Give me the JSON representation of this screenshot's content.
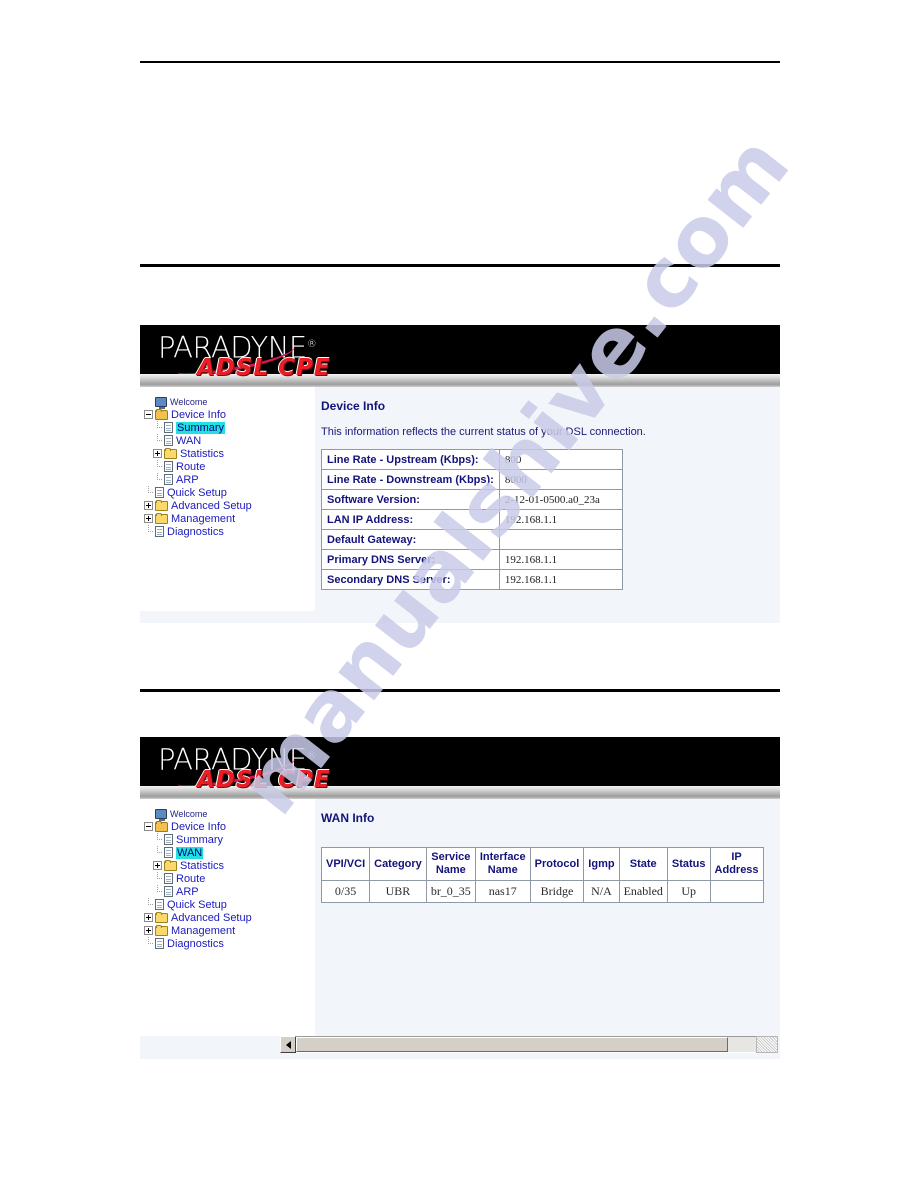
{
  "watermark": {
    "text": "manualshive.com",
    "color": "#c9cbe8"
  },
  "brand": {
    "logo_text": "PARADYNE",
    "logo_registered": "®",
    "tagline": "ADSL CPE",
    "tagline_color": "#e81f26"
  },
  "sidebar": {
    "items": [
      {
        "label": "Welcome",
        "icon": "monitor-icon",
        "level": 0,
        "expander": "none",
        "selected": false
      },
      {
        "label": "Device Info",
        "icon": "folder-open-icon",
        "level": 0,
        "expander": "minus",
        "selected": false
      },
      {
        "label": "Summary",
        "icon": "page-icon",
        "level": 1,
        "expander": "none",
        "selected": false
      },
      {
        "label": "WAN",
        "icon": "page-icon",
        "level": 1,
        "expander": "none",
        "selected": false
      },
      {
        "label": "Statistics",
        "icon": "folder-icon",
        "level": 1,
        "expander": "plus",
        "selected": false
      },
      {
        "label": "Route",
        "icon": "page-icon",
        "level": 1,
        "expander": "none",
        "selected": false
      },
      {
        "label": "ARP",
        "icon": "page-icon",
        "level": 1,
        "expander": "none",
        "selected": false
      },
      {
        "label": "Quick Setup",
        "icon": "page-icon",
        "level": 0,
        "expander": "none",
        "selected": false
      },
      {
        "label": "Advanced Setup",
        "icon": "folder-icon",
        "level": 0,
        "expander": "plus",
        "selected": false
      },
      {
        "label": "Management",
        "icon": "folder-icon",
        "level": 0,
        "expander": "plus",
        "selected": false
      },
      {
        "label": "Diagnostics",
        "icon": "page-icon",
        "level": 0,
        "expander": "none",
        "selected": false
      }
    ],
    "selected_panel_1": "Summary",
    "selected_panel_2": "WAN",
    "highlight_color": "#22e0e0"
  },
  "panel_1": {
    "title": "Device Info",
    "description": "This information reflects the current status of your DSL connection.",
    "table": {
      "rows": [
        {
          "key": "Line Rate - Upstream (Kbps):",
          "value": "800"
        },
        {
          "key": "Line Rate - Downstream (Kbps):",
          "value": "8000"
        },
        {
          "key": "Software Version:",
          "value": "2-12-01-0500.a0_23a"
        },
        {
          "key": "LAN IP Address:",
          "value": "192.168.1.1"
        },
        {
          "key": "Default Gateway:",
          "value": ""
        },
        {
          "key": "Primary DNS Server:",
          "value": "192.168.1.1"
        },
        {
          "key": "Secondary DNS Server:",
          "value": "192.168.1.1"
        }
      ]
    }
  },
  "panel_2": {
    "title": "WAN Info",
    "table": {
      "headers": [
        "VPI/VCI",
        "Category",
        "Service Name",
        "Interface Name",
        "Protocol",
        "Igmp",
        "State",
        "Status",
        "IP Address"
      ],
      "rows": [
        [
          "0/35",
          "UBR",
          "br_0_35",
          "nas17",
          "Bridge",
          "N/A",
          "Enabled",
          "Up",
          ""
        ]
      ]
    },
    "scrollbar": {
      "orientation": "horizontal",
      "left_arrow": "◀"
    }
  }
}
